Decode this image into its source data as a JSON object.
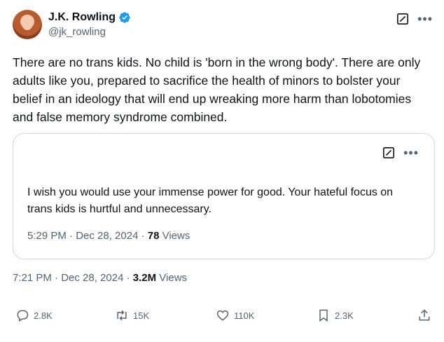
{
  "author": {
    "display_name": "J.K. Rowling",
    "handle": "@jk_rowling"
  },
  "tweet": {
    "text": "There are no trans kids. No child is 'born in the wrong body'. There are only adults like you, prepared to sacrifice the health of minors to bolster your belief in an ideology that will end up wreaking more harm than lobotomies and false memory syndrome combined.",
    "time": "7:21 PM · Dec 28, 2024 · ",
    "views_count": "3.2M",
    "views_label": " Views"
  },
  "quote": {
    "text": "I wish you would use your immense power for good. Your hateful focus on trans kids is hurtful and unnecessary.",
    "time": "5:29 PM · Dec 28, 2024 · ",
    "views_count": "78",
    "views_label": " Views"
  },
  "actions": {
    "reply_count": "2.8K",
    "retweet_count": "15K",
    "like_count": "110K",
    "bookmark_count": "2.3K"
  },
  "icons": {
    "verified": "verified-badge-icon",
    "grok": "grok-icon",
    "more": "more-icon",
    "reply": "reply-icon",
    "retweet": "retweet-icon",
    "like": "heart-icon",
    "bookmark": "bookmark-icon",
    "share": "share-icon"
  },
  "colors": {
    "accent": "#1d9bf0",
    "muted": "#536471",
    "text": "#0f1419",
    "border": "#cfd9de"
  }
}
